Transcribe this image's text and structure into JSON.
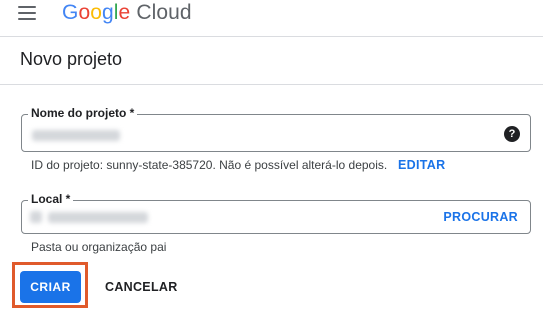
{
  "header": {
    "logo_letters": [
      "G",
      "o",
      "o",
      "g",
      "l",
      "e"
    ],
    "logo_suffix": "Cloud"
  },
  "page": {
    "title": "Novo projeto"
  },
  "project_name": {
    "label": "Nome do projeto *",
    "help_icon": "help-icon"
  },
  "project_id": {
    "text": "ID do projeto: sunny-state-385720. Não é possível alterá-lo depois.",
    "edit_label": "EDITAR"
  },
  "location": {
    "label": "Local *",
    "browse_label": "PROCURAR",
    "helper": "Pasta ou organização pai"
  },
  "actions": {
    "create_label": "CRIAR",
    "cancel_label": "CANCELAR"
  },
  "colors": {
    "primary": "#1a73e8",
    "highlight_border": "#e05a2b"
  }
}
